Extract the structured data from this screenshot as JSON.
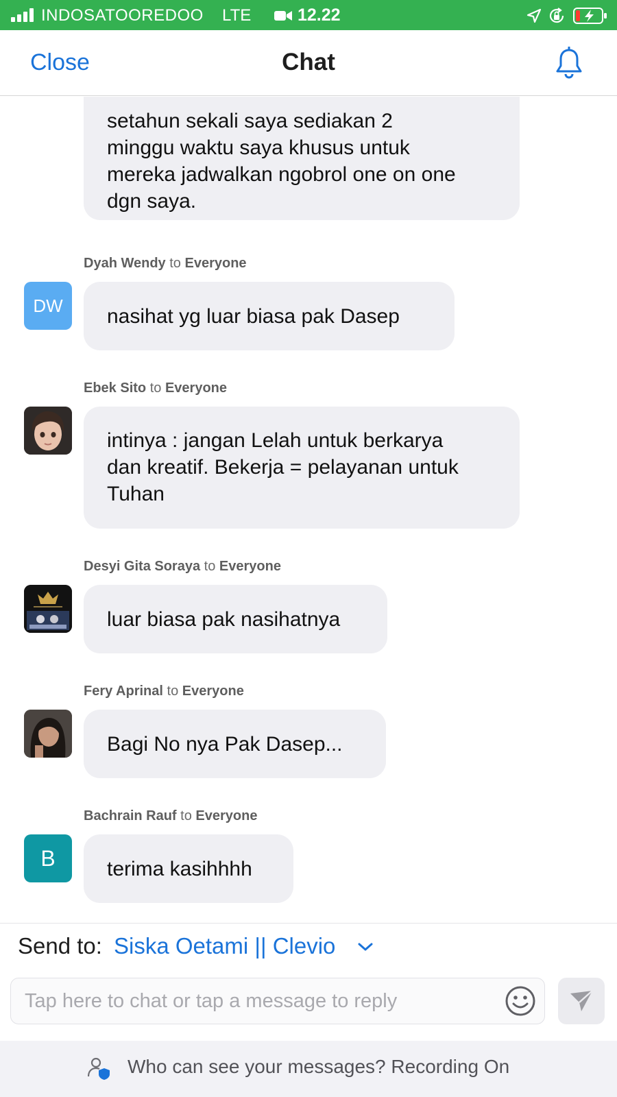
{
  "status_bar": {
    "carrier": "INDOSATOOREDOO",
    "network": "LTE",
    "time": "12.22",
    "icons": [
      "signal-icon",
      "video-camera-icon",
      "location-arrow-icon",
      "rotation-lock-icon",
      "battery-charging-icon"
    ]
  },
  "header": {
    "close_label": "Close",
    "title": "Chat",
    "bell_icon": "bell-icon"
  },
  "messages": [
    {
      "sender": "",
      "recipient": "",
      "text_lines": [
        "setahun sekali saya sediakan 2",
        "minggu waktu saya khusus untuk",
        "mereka jadwalkan ngobrol one on one",
        "dgn saya."
      ]
    },
    {
      "sender": "Dyah Wendy",
      "to_word": "to",
      "recipient": "Everyone",
      "avatar_initials": "DW",
      "avatar_color": "#5aacf2",
      "text": "nasihat yg luar biasa pak Dasep"
    },
    {
      "sender": "Ebek Sito",
      "to_word": "to",
      "recipient": "Everyone",
      "avatar_type": "photo",
      "text_lines": [
        "intinya : jangan Lelah untuk berkarya",
        "dan kreatif. Bekerja = pelayanan untuk",
        "Tuhan"
      ]
    },
    {
      "sender": "Desyi Gita Soraya",
      "to_word": "to",
      "recipient": "Everyone",
      "avatar_type": "photo",
      "text": "luar biasa pak nasihatnya"
    },
    {
      "sender": "Fery Aprinal",
      "to_word": "to",
      "recipient": "Everyone",
      "avatar_type": "photo",
      "text": "Bagi No nya Pak Dasep..."
    },
    {
      "sender": "Bachrain Rauf",
      "to_word": "to",
      "recipient": "Everyone",
      "avatar_initials": "B",
      "avatar_color": "#0f98a3",
      "text": "terima kasihhhh"
    }
  ],
  "send_to": {
    "label": "Send to:",
    "recipient": "Siska Oetami || Clevio"
  },
  "composer": {
    "placeholder": "Tap here to chat or tap a message to reply",
    "value": ""
  },
  "footer": {
    "text": "Who can see your messages? Recording On"
  },
  "colors": {
    "status_bar": "#34b151",
    "accent_blue": "#1a73d9",
    "bubble": "#efeff3"
  }
}
